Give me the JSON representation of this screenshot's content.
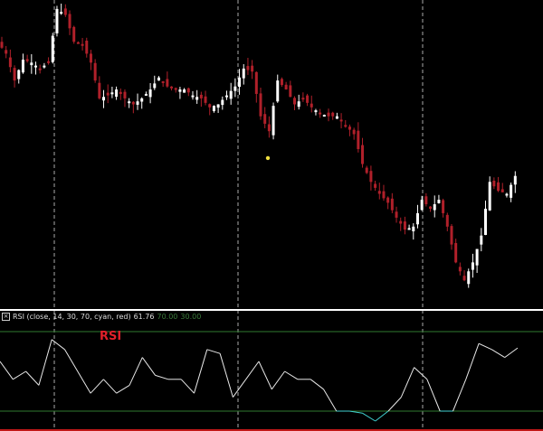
{
  "indicator_header": {
    "close_icon": "close-box-icon",
    "label": "RSI (close, 14, 30, 70, cyan, red)",
    "value": "61.76",
    "upper": "70.00",
    "lower": "30.00"
  },
  "rsi_title": "RSI",
  "colors": {
    "up": "#ffffff",
    "down": "#b0202a",
    "rsi_line": "#e8e8e8",
    "rsi_low": "#40d0d0",
    "levels": "#2f7a2f",
    "divider": "#ffffff",
    "bottom": "#c01818",
    "marker": "#f0e040"
  },
  "chart_data": [
    {
      "type": "candlestick",
      "title": "",
      "xlabel": "",
      "ylabel": "",
      "ylim": [
        0,
        100
      ],
      "closes": [
        86,
        82,
        73,
        80,
        79,
        77,
        79,
        97,
        95,
        86,
        85,
        79,
        67,
        68,
        70,
        67,
        65,
        67,
        70,
        74,
        71,
        70,
        70,
        68,
        67,
        64,
        65,
        68,
        71,
        77,
        76,
        61,
        56,
        73,
        70,
        65,
        67,
        64,
        62,
        61,
        61,
        58,
        55,
        45,
        39,
        35,
        32,
        27,
        23,
        24,
        33,
        30,
        33,
        24,
        12,
        6,
        12,
        21,
        39,
        36,
        35,
        41
      ],
      "marker_value": 47
    },
    {
      "type": "line",
      "title": "RSI",
      "ylim": [
        0,
        100
      ],
      "levels": [
        70,
        30
      ],
      "values": [
        55,
        46,
        50,
        43,
        66,
        61,
        50,
        39,
        46,
        39,
        43,
        57,
        48,
        46,
        46,
        39,
        61,
        59,
        37,
        46,
        55,
        41,
        50,
        46,
        46,
        41,
        30,
        30,
        29,
        25,
        30,
        37,
        52,
        46,
        30,
        30,
        46,
        64,
        61,
        57,
        61.76
      ]
    }
  ]
}
